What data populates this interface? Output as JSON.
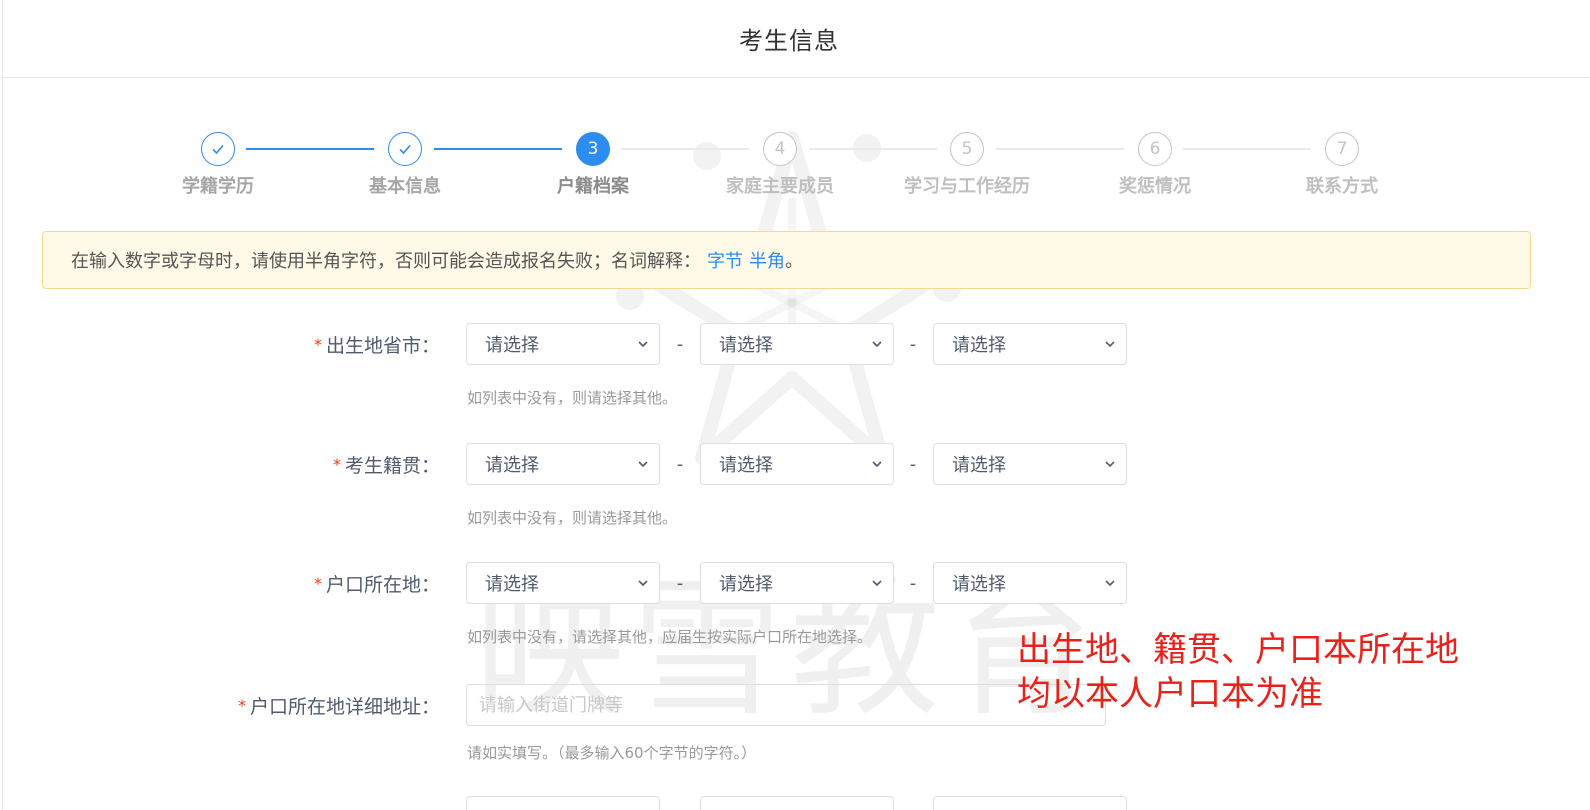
{
  "header": {
    "title": "考生信息"
  },
  "steps": [
    {
      "num": "1",
      "title": "学籍学历",
      "status": "done"
    },
    {
      "num": "2",
      "title": "基本信息",
      "status": "done"
    },
    {
      "num": "3",
      "title": "户籍档案",
      "status": "active"
    },
    {
      "num": "4",
      "title": "家庭主要成员",
      "status": "wait"
    },
    {
      "num": "5",
      "title": "学习与工作经历",
      "status": "wait"
    },
    {
      "num": "6",
      "title": "奖惩情况",
      "status": "wait"
    },
    {
      "num": "7",
      "title": "联系方式",
      "status": "wait"
    }
  ],
  "notice": {
    "text": "在输入数字或字母时，请使用半角字符，否则可能会造成报名失败；名词解释：",
    "link_byte": "字节",
    "link_halfwidth": "半角",
    "suffix": "。"
  },
  "form": {
    "required_mark": "*",
    "separator": "-",
    "select_placeholder": "请选择",
    "birthplace": {
      "label": "出生地省市：",
      "hint": "如列表中没有，则请选择其他。"
    },
    "native_place": {
      "label": "考生籍贯：",
      "hint": "如列表中没有，则请选择其他。"
    },
    "hukou": {
      "label": "户口所在地：",
      "hint": "如列表中没有，请选择其他，应届生按实际户口所在地选择。"
    },
    "hukou_address": {
      "label": "户口所在地详细地址：",
      "placeholder": "请输入街道门牌等",
      "hint": "请如实填写。（最多输入60个字节的字符。）"
    }
  },
  "annotation": {
    "line1": "出生地、籍贯、户口本所在地",
    "line2": "均以本人户口本为准"
  },
  "watermark": {
    "text": "映雪教育"
  },
  "colors": {
    "primary": "#2d8cf0",
    "required": "#ed4014",
    "annotation": "#e8211a",
    "notice_bg": "#fff9e8"
  },
  "icons": {
    "done_step": "check-icon",
    "select": "chevron-down-icon"
  }
}
